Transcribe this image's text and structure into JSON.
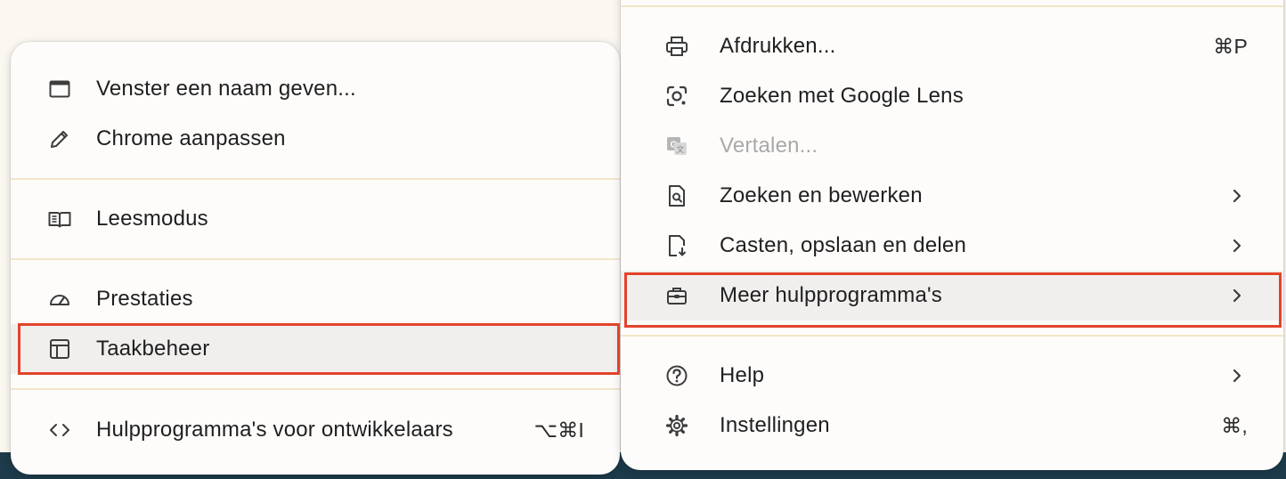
{
  "left_menu": {
    "items": [
      {
        "label": "Venster een naam geven...",
        "icon": "window-icon"
      },
      {
        "label": "Chrome aanpassen",
        "icon": "pencil-icon"
      },
      {
        "label": "Leesmodus",
        "icon": "book-icon"
      },
      {
        "label": "Prestaties",
        "icon": "gauge-icon"
      },
      {
        "label": "Taakbeheer",
        "icon": "task-manager-icon"
      },
      {
        "label": "Hulpprogramma's voor ontwikkelaars",
        "icon": "code-icon",
        "shortcut": "⌥⌘I"
      }
    ]
  },
  "right_menu": {
    "items": [
      {
        "label": "Afdrukken...",
        "icon": "printer-icon",
        "shortcut": "⌘P"
      },
      {
        "label": "Zoeken met Google Lens",
        "icon": "lens-icon"
      },
      {
        "label": "Vertalen...",
        "icon": "translate-icon",
        "disabled": true
      },
      {
        "label": "Zoeken en bewerken",
        "icon": "find-page-icon",
        "submenu": true
      },
      {
        "label": "Casten, opslaan en delen",
        "icon": "save-page-icon",
        "submenu": true
      },
      {
        "label": "Meer hulpprogramma's",
        "icon": "toolbox-icon",
        "submenu": true
      },
      {
        "label": "Help",
        "icon": "help-icon",
        "submenu": true
      },
      {
        "label": "Instellingen",
        "icon": "gear-icon",
        "shortcut": "⌘,"
      }
    ]
  },
  "colors": {
    "highlight": "#e2432a",
    "divider": "#f1e6c9",
    "menu_bg": "#fefcfb",
    "hover_bg": "#f1efee"
  }
}
